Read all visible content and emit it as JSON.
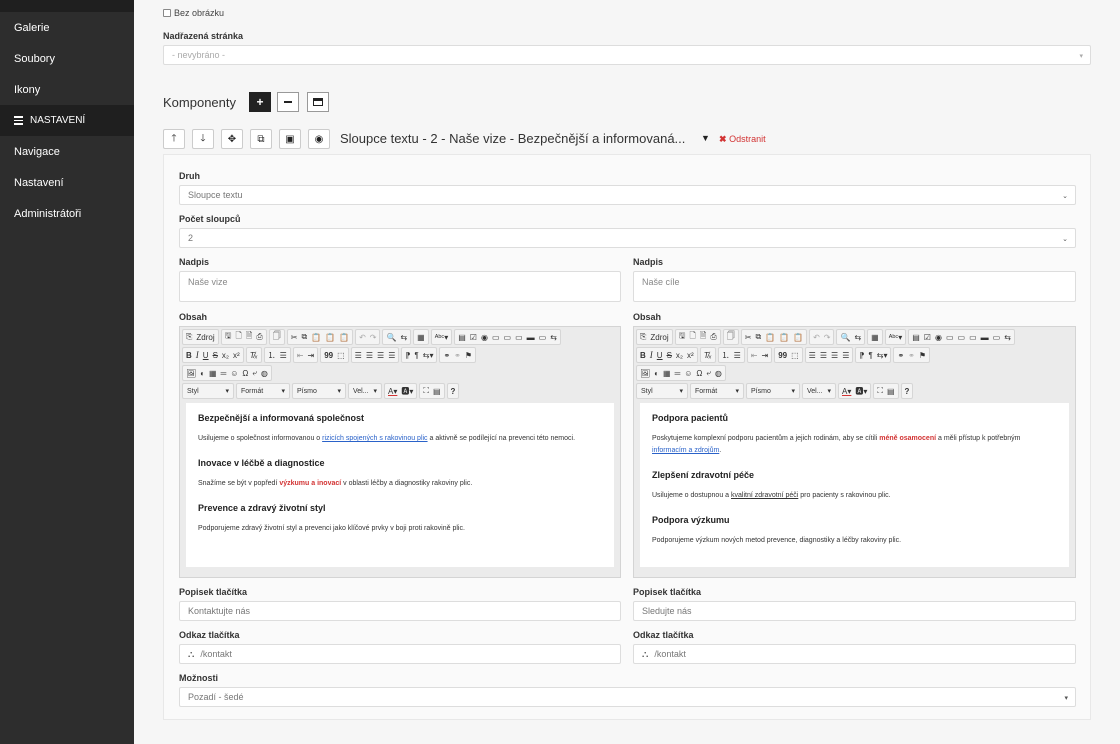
{
  "sidebar": {
    "items": [
      {
        "label": "Galerie"
      },
      {
        "label": "Soubory"
      },
      {
        "label": "Ikony"
      },
      {
        "label": "NASTAVENÍ"
      },
      {
        "label": "Navigace"
      },
      {
        "label": "Nastavení"
      },
      {
        "label": "Administrátoři"
      }
    ]
  },
  "top": {
    "no_image_label": "Bez obrázku",
    "parent_label": "Nadřazená stránka",
    "parent_value": "- nevybráno -"
  },
  "components": {
    "title": "Komponenty",
    "component_title": "Sloupce textu - 2 - Naše vize - Bezpečnější a informovaná...",
    "remove_label": "Odstranit"
  },
  "form": {
    "druh_label": "Druh",
    "druh_value": "Sloupce textu",
    "pocet_label": "Počet sloupců",
    "pocet_value": "2",
    "options_label": "Možnosti",
    "options_value": "Pozadí - šedé"
  },
  "columns": [
    {
      "heading_label": "Nadpis",
      "heading_value": "Naše vize",
      "content_label": "Obsah",
      "button_label_label": "Popisek tlačítka",
      "button_label_value": "Kontaktujte nás",
      "button_link_label": "Odkaz tlačítka",
      "button_link_value": "/kontakt",
      "content": {
        "h1": "Bezpečnější a informovaná společnost",
        "p1a": "Usilujeme o společnost informovanou o ",
        "p1link": "rizicích spojených s rakovinou plic",
        "p1b": " a aktivně se podílející na prevenci této nemoci.",
        "h2": "Inovace v léčbě a diagnostice",
        "p2a": "Snažíme se být v popředí ",
        "p2red": "výzkumu a inovací",
        "p2b": " v oblasti léčby a diagnostiky rakoviny plic.",
        "h3": "Prevence a zdravý životní styl",
        "p3": "Podporujeme zdravý životní styl a prevenci jako klíčové prvky v boji proti rakovině plic."
      }
    },
    {
      "heading_label": "Nadpis",
      "heading_value": "Naše cíle",
      "content_label": "Obsah",
      "button_label_label": "Popisek tlačítka",
      "button_label_value": "Sledujte nás",
      "button_link_label": "Odkaz tlačítka",
      "button_link_value": "/kontakt",
      "content": {
        "h1": "Podpora pacientů",
        "p1a": "Poskytujeme komplexní podporu pacientům a jejich rodinám, aby se cítili ",
        "p1red": "méně osamocení",
        "p1b": " a měli přístup k potřebným ",
        "p1link": "informacím a zdrojům",
        "p1c": ".",
        "h2": "Zlepšení zdravotní péče",
        "p2a": "Usilujeme o dostupnou a ",
        "p2u": "kvalitní zdravotní péči",
        "p2b": " pro pacienty s rakovinou plic.",
        "h3": "Podpora výzkumu",
        "p3": "Podporujeme výzkum nových metod prevence, diagnostiky a léčby rakoviny plic."
      }
    }
  ],
  "editor": {
    "source_label": "Zdroj",
    "style_label": "Styl",
    "format_label": "Formát",
    "font_label": "Písmo",
    "size_label": "Vel...",
    "help_label": "?"
  }
}
